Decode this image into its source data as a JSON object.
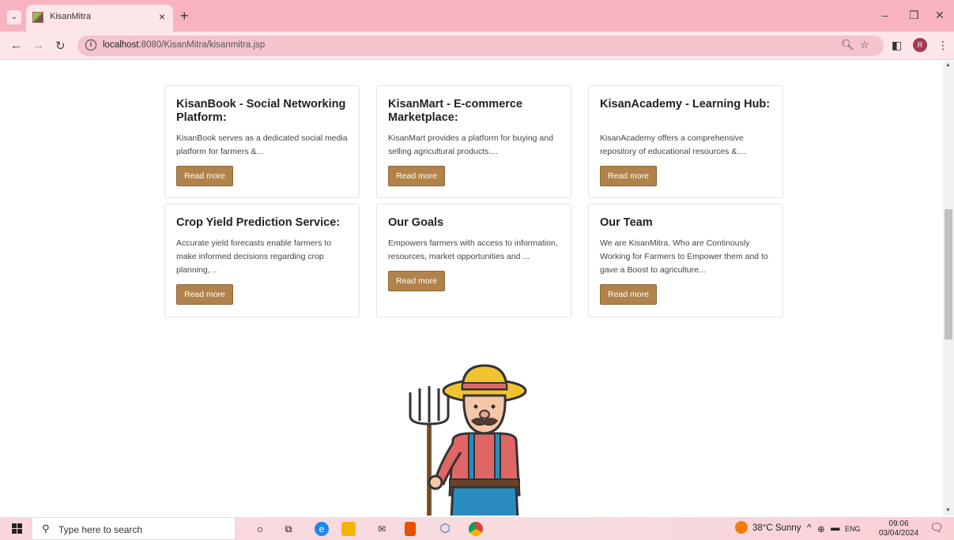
{
  "browser": {
    "tab_title": "KisanMitra",
    "url_host": "localhost",
    "url_rest": ":8080/KisanMitra/kisanmitra.jsp",
    "avatar_letter": "R"
  },
  "cards": [
    {
      "title": "KisanBook - Social Networking Platform:",
      "text": "KisanBook serves as a dedicated social media platform for farmers &...",
      "button": "Read more"
    },
    {
      "title": "KisanMart - E-commerce Marketplace:",
      "text": "KisanMart provides a platform for buying and selling agricultural products....",
      "button": "Read more"
    },
    {
      "title": "KisanAcademy - Learning Hub:",
      "text": "KisanAcademy offers a comprehensive repository of educational resources &....",
      "button": "Read more"
    },
    {
      "title": "Crop Yield Prediction Service:",
      "text": "Accurate yield forecasts enable farmers to make informed decisions regarding crop planning, ..",
      "button": "Read more"
    },
    {
      "title": "Our Goals",
      "text": "Empowers farmers with access to information, resources, market opportunities and ...",
      "button": "Read more"
    },
    {
      "title": "Our Team",
      "text": "We are KisanMitra. Who are Continously Working for Farmers to Empower them and to gave a Boost to agriculture...",
      "button": "Read more"
    }
  ],
  "taskbar": {
    "search_placeholder": "Type here to search",
    "weather": "38°C  Sunny",
    "lang": "ENG",
    "time": "09:06",
    "date": "03/04/2024"
  }
}
